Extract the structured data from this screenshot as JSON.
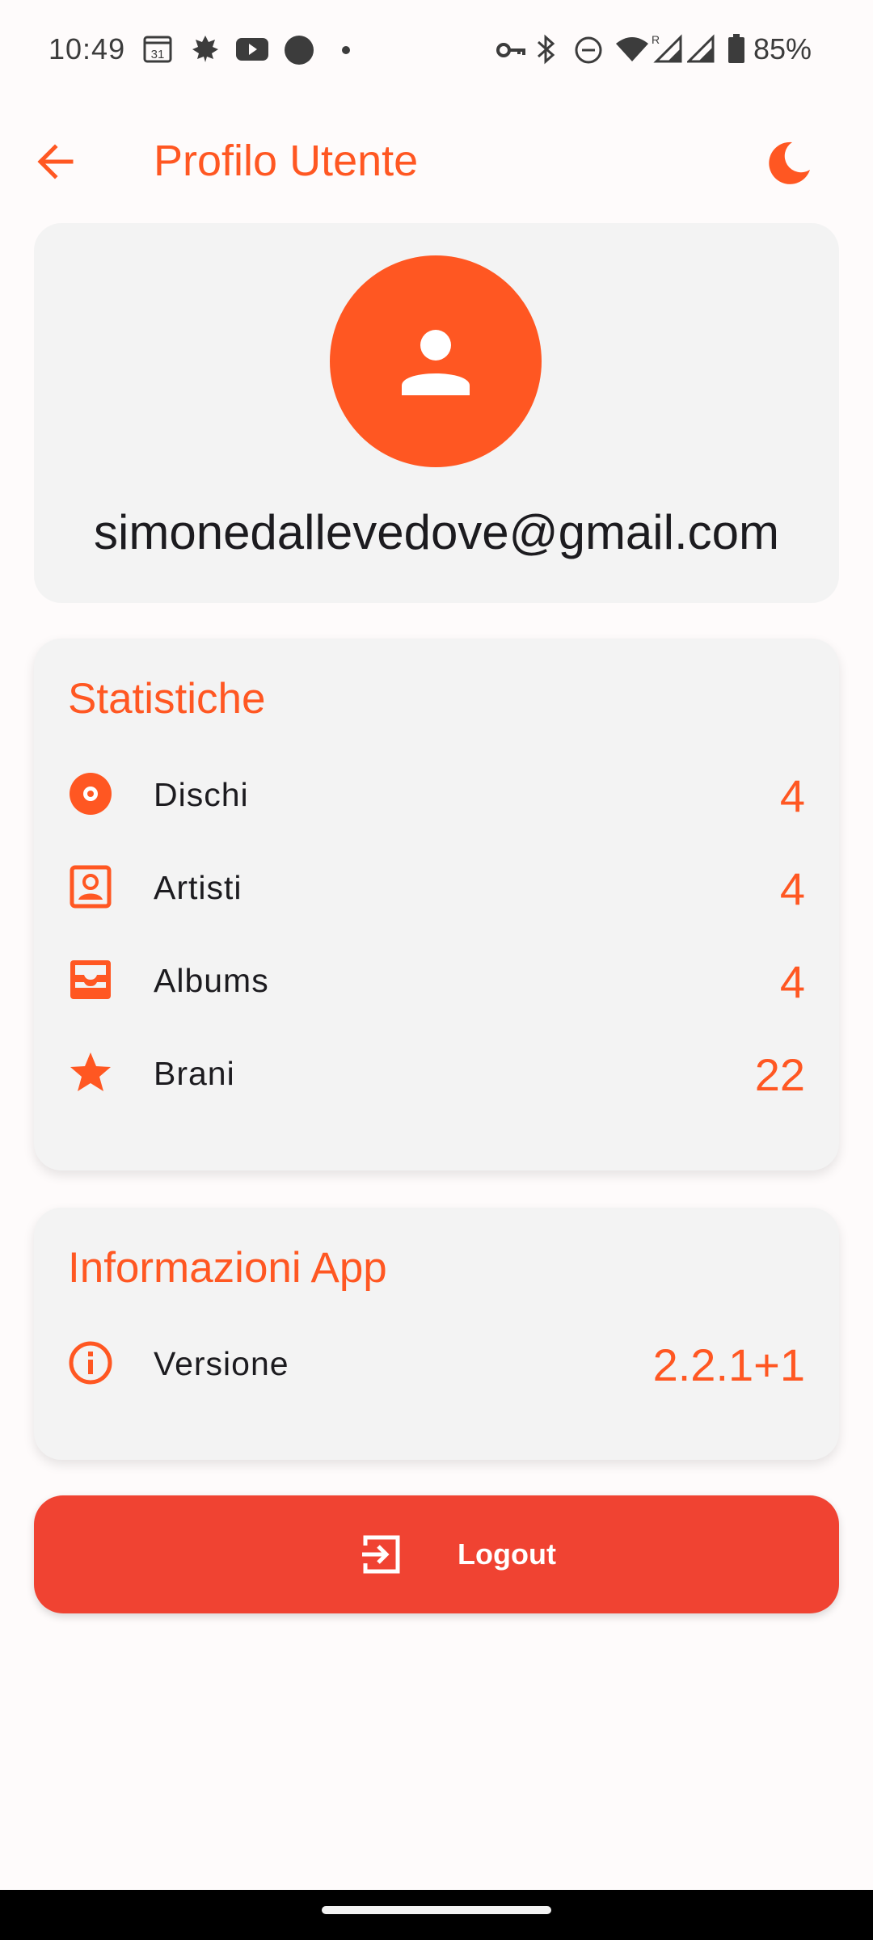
{
  "status_bar": {
    "time": "10:49",
    "battery_percent": "85%",
    "calendar_day": "31",
    "left_icons": [
      "calendar-icon",
      "maple-leaf-icon",
      "youtube-icon",
      "circle-notification-icon",
      "more-dot-icon"
    ],
    "right_icons": [
      "vpn-key-icon",
      "bluetooth-icon",
      "do-not-disturb-icon",
      "wifi-icon",
      "signal-roaming-icon",
      "signal-icon",
      "battery-icon"
    ]
  },
  "app_bar": {
    "title": "Profilo Utente",
    "back_icon": "arrow-back-icon",
    "theme_icon": "dark-mode-moon-icon"
  },
  "profile": {
    "avatar_icon": "person-icon",
    "email": "simonedallevedove@gmail.com"
  },
  "stats": {
    "title": "Statistiche",
    "items": [
      {
        "label": "Dischi",
        "value": "4",
        "icon": "disc-icon"
      },
      {
        "label": "Artisti",
        "value": "4",
        "icon": "artist-portrait-icon"
      },
      {
        "label": "Albums",
        "value": "4",
        "icon": "album-inbox-icon"
      },
      {
        "label": "Brani",
        "value": "22",
        "icon": "star-icon"
      }
    ]
  },
  "app_info": {
    "title": "Informazioni App",
    "version_label": "Versione",
    "version_value": "2.2.1+1",
    "icon": "info-icon"
  },
  "logout": {
    "label": "Logout",
    "icon": "login-arrow-icon"
  },
  "colors": {
    "accent": "#FF5722",
    "logout": "#F04332",
    "card": "#F3F3F3",
    "background": "#FEFBFB"
  }
}
